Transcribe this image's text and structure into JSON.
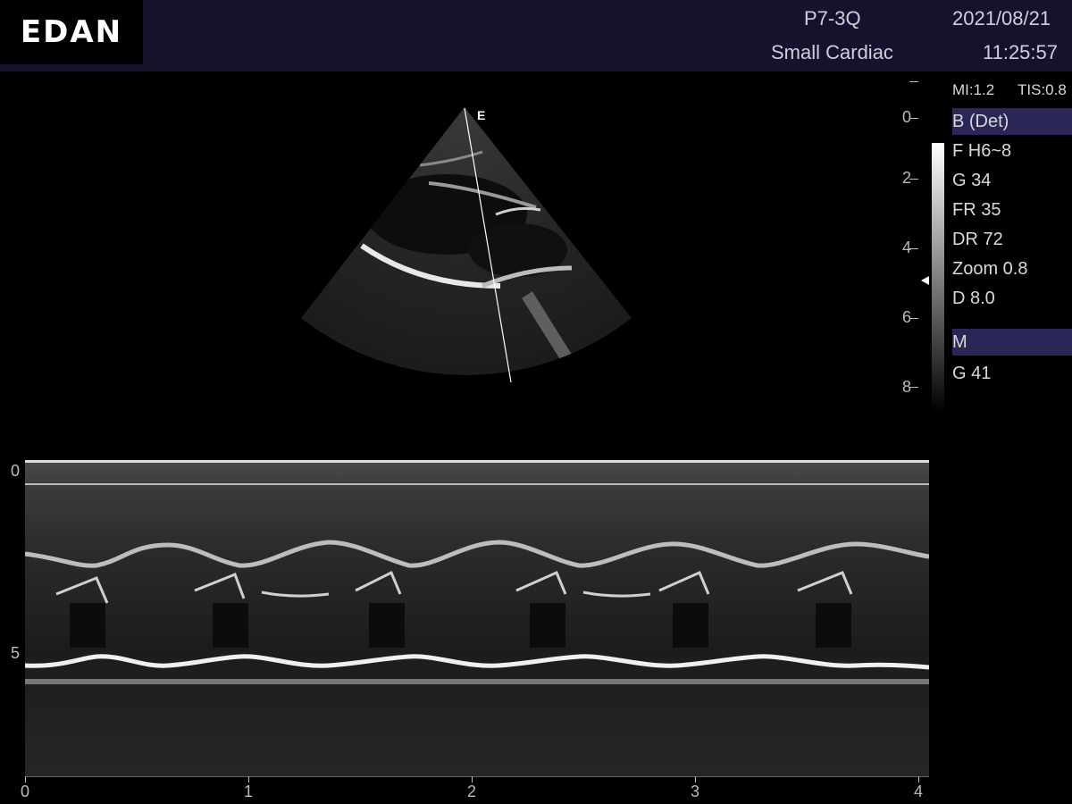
{
  "header": {
    "brand": "EDAN",
    "probe": "P7-3Q",
    "preset": "Small Cardiac",
    "date": "2021/08/21",
    "time": "11:25:57"
  },
  "indices": {
    "mi": "MI:1.2",
    "tis": "TIS:0.8"
  },
  "b_mode": {
    "title": "B (Det)",
    "params": [
      "F H6~8",
      "G 34",
      "FR 35",
      "DR 72",
      "Zoom 0.8",
      "D 8.0"
    ]
  },
  "m_mode": {
    "title": "M",
    "params": [
      "G 41"
    ]
  },
  "sector": {
    "marker": "E"
  },
  "depth_scale": {
    "labels": [
      "0",
      "2",
      "4",
      "6",
      "8"
    ]
  },
  "mmode_depth_scale": {
    "labels": [
      "0",
      "5"
    ]
  },
  "time_axis": {
    "labels": [
      "0",
      "1",
      "2",
      "3",
      "4"
    ]
  },
  "colors": {
    "header_bg": "#16122e",
    "mode_bar": "#2a2656"
  }
}
